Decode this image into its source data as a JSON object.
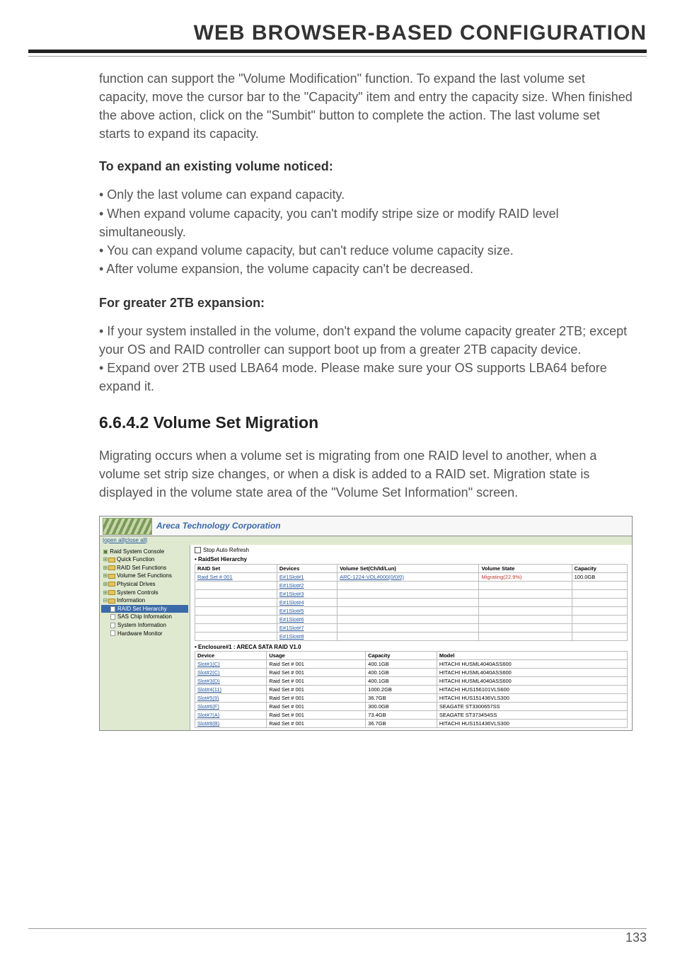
{
  "page_title": "WEB BROWSER-BASED CONFIGURATION",
  "intro": "function can support the \"Volume Modification\" function. To expand the last volume set capacity, move the cursor bar to the \"Capacity\" item and entry the capacity size. When finished the above action, click on the \"Sumbit\" button to complete the action. The last volume set starts to expand its capacity.",
  "sub1_head": "To expand an existing volume noticed:",
  "sub1_bullets": [
    "• Only the last volume can expand capacity.",
    "• When expand volume capacity, you can't modify stripe size or modify RAID level simultaneously.",
    "• You can expand volume capacity, but can't reduce volume capacity size.",
    "• After volume expansion, the volume capacity can't be decreased."
  ],
  "sub2_head": "For greater 2TB expansion:",
  "sub2_bullets": [
    "• If your system installed in the volume, don't expand the volume capacity greater 2TB; except your OS and RAID controller can support boot up from a greater 2TB capacity device.",
    "• Expand over 2TB used LBA64 mode. Please make sure your OS supports LBA64 before expand it."
  ],
  "section_title": "6.6.4.2 Volume Set Migration",
  "section_para": "Migrating occurs when a volume set is migrating from one RAID level to another, when a volume set strip size changes, or when a disk is added to a RAID set. Migration state is displayed in the volume state area of the \"Volume Set Information\" screen.",
  "page_number": "133",
  "shot": {
    "banner_title": "Areca Technology Corporation",
    "open_close": "|open all|close all|",
    "nav": {
      "root": "Raid System Console",
      "items": [
        "Quick Function",
        "RAID Set Functions",
        "Volume Set Functions",
        "Physical Drives",
        "System Controls",
        "Information"
      ],
      "info_children": [
        "RAID Set Hierarchy",
        "SAS Chip Information",
        "System Information",
        "Hardware Monitor"
      ],
      "selected_index": 0
    },
    "stop_refresh": "Stop Auto Refresh",
    "rs_header": "• RaidSet Hierarchy",
    "rs_cols": [
      "RAID Set",
      "Devices",
      "Volume Set(Ch/Id/Lun)",
      "Volume State",
      "Capacity"
    ],
    "rs_raidset": "Raid Set # 001",
    "rs_devices": [
      "E#1Slot#1",
      "E#1Slot#2",
      "E#1Slot#3",
      "E#1Slot#4",
      "E#1Slot#5",
      "E#1Slot#6",
      "E#1Slot#7",
      "E#1Slot#8"
    ],
    "rs_volset": "ARC-1224-VOL#000(0/0/0)",
    "rs_state": "Migrating(22.9%)",
    "rs_cap": "100.0GB",
    "enc_header": "• Enclosure#1 : ARECA SATA RAID V1.0",
    "enc_cols": [
      "Device",
      "Usage",
      "Capacity",
      "Model"
    ],
    "enc_rows": [
      {
        "dev": "Slot#1(C)",
        "usage": "Raid Set # 001",
        "cap": "400.1GB",
        "model": "HITACHI HUSML4040ASS600"
      },
      {
        "dev": "Slot#2(C)",
        "usage": "Raid Set # 001",
        "cap": "400.1GB",
        "model": "HITACHI HUSML4040ASS600"
      },
      {
        "dev": "Slot#3(D)",
        "usage": "Raid Set # 001",
        "cap": "400.1GB",
        "model": "HITACHI HUSML4040ASS600"
      },
      {
        "dev": "Slot#4(11)",
        "usage": "Raid Set # 001",
        "cap": "1000.2GB",
        "model": "HITACHI HUS156101VLS600"
      },
      {
        "dev": "Slot#5(9)",
        "usage": "Raid Set # 001",
        "cap": "36.7GB",
        "model": "HITACHI HUS151436VLS300"
      },
      {
        "dev": "Slot#6(F)",
        "usage": "Raid Set # 001",
        "cap": "300.0GB",
        "model": "SEAGATE ST3300657SS"
      },
      {
        "dev": "Slot#7(A)",
        "usage": "Raid Set # 001",
        "cap": "73.4GB",
        "model": "SEAGATE ST373454SS"
      },
      {
        "dev": "Slot#8(B)",
        "usage": "Raid Set # 001",
        "cap": "36.7GB",
        "model": "HITACHI HUS151436VLS300"
      }
    ]
  }
}
